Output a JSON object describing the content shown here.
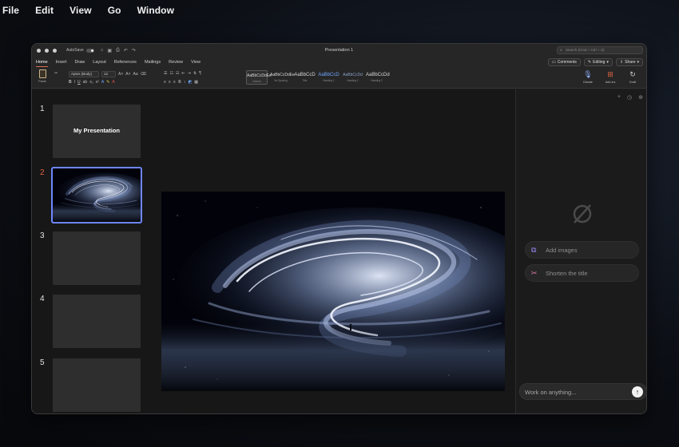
{
  "menu": [
    "File",
    "Edit",
    "View",
    "Go",
    "Window"
  ],
  "window": {
    "autosave_label": "AutoSave",
    "title": "Presentation 1",
    "search_placeholder": "Search (Cmd + Ctrl + U)"
  },
  "tabs": [
    "Home",
    "Insert",
    "Draw",
    "Layout",
    "References",
    "Mailings",
    "Review",
    "View"
  ],
  "active_tab": "Home",
  "tab_actions": {
    "comments": "Comments",
    "editing": "Editing",
    "share": "Share"
  },
  "ribbon": {
    "paste_label": "Paste",
    "font_name": "Aptos (Body)",
    "font_size": "12",
    "styles": [
      {
        "sample": "AaBbCcDdEe",
        "name": "Normal"
      },
      {
        "sample": "AaBbCcDdEe",
        "name": "No Spacing"
      },
      {
        "sample": "AaBbCcD",
        "name": "Title"
      },
      {
        "sample": "AaBbCcD",
        "name": "Heading 1"
      },
      {
        "sample": "AaBbCcDd",
        "name": "Heading 2"
      },
      {
        "sample": "AaBbCcDd",
        "name": "Heading 3"
      }
    ],
    "dictate_label": "Dictate",
    "addins_label": "Add-ins",
    "draft_label": "Draft"
  },
  "slides": [
    {
      "number": "1",
      "title": "My Presentation"
    },
    {
      "number": "2",
      "title": ""
    },
    {
      "number": "3",
      "title": ""
    },
    {
      "number": "4",
      "title": ""
    },
    {
      "number": "5",
      "title": ""
    }
  ],
  "active_slide": "2",
  "copilot": {
    "suggestions": [
      "Add images",
      "Shorten the title"
    ],
    "composer_placeholder": "Work on anything..."
  },
  "colors": {
    "accent_tab": "#d86b52",
    "active_slide_number": "#e0643f",
    "selection_outline": "#6f86ff"
  }
}
